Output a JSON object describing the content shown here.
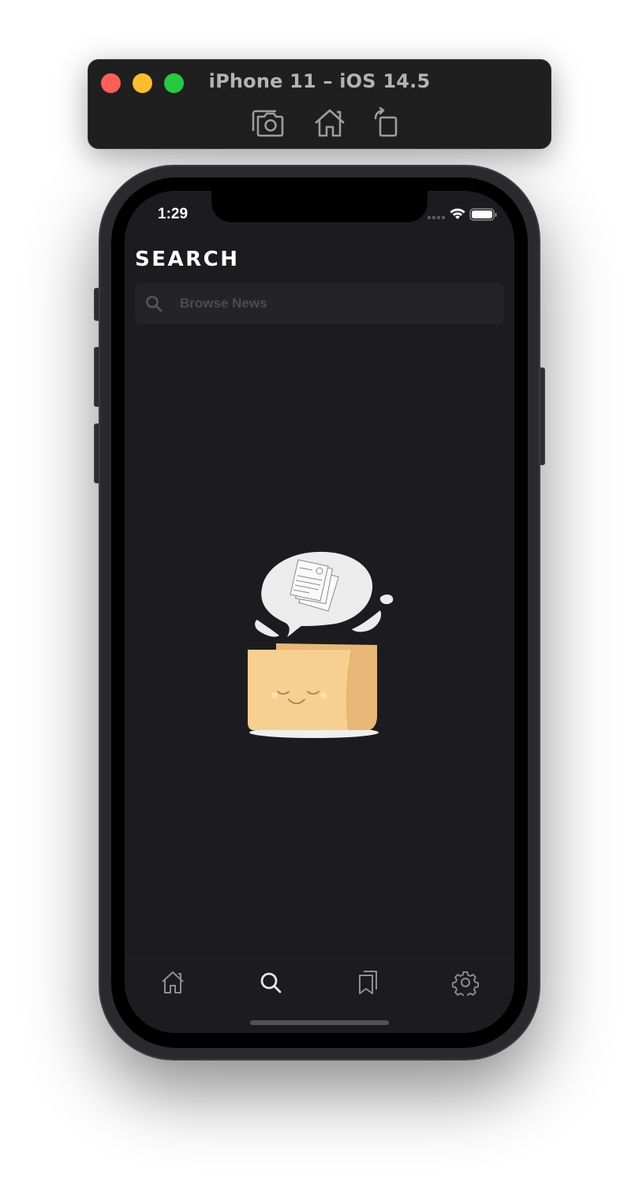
{
  "simulator": {
    "title": "iPhone 11 – iOS 14.5",
    "tools": [
      "screenshot-icon",
      "home-icon",
      "rotate-icon"
    ]
  },
  "status_bar": {
    "time": "1:29",
    "icons": [
      "cellular-icon",
      "wifi-icon",
      "battery-icon"
    ]
  },
  "page": {
    "title": "SEARCH"
  },
  "search": {
    "placeholder": "Browse News",
    "value": ""
  },
  "empty_state": {
    "illustration": "folder-with-news-illustration"
  },
  "tab_bar": {
    "items": [
      {
        "icon": "home-icon",
        "active": false
      },
      {
        "icon": "search-icon",
        "active": true
      },
      {
        "icon": "bookmarks-icon",
        "active": false
      },
      {
        "icon": "settings-icon",
        "active": false
      }
    ]
  },
  "colors": {
    "screen_bg": "#1c1c1e",
    "search_bg": "#242426",
    "placeholder": "#4d4d51",
    "folder": "#f7cf91",
    "folder_shade": "#e6b877",
    "tab_inactive": "#8e8e93",
    "tab_active": "#e5e5ea"
  }
}
